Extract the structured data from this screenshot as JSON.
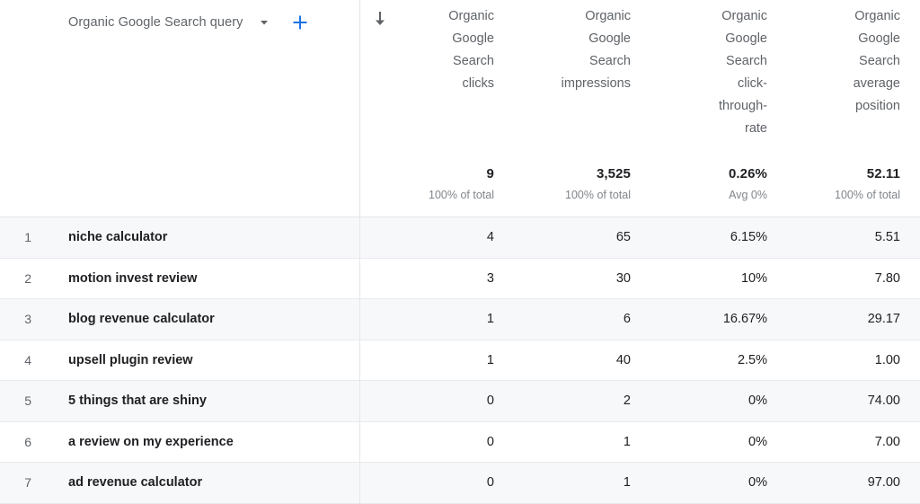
{
  "colors": {
    "accent_blue": "#1a73e8",
    "text_primary": "#202124",
    "text_secondary": "#5f6368",
    "text_muted": "#80868b",
    "row_shade": "#f7f8f9",
    "divider": "#e8eaed"
  },
  "dimension_selector": {
    "label": "Organic Google Search query",
    "caret_icon": "chevron-down-icon",
    "add_icon": "plus-icon"
  },
  "sort": {
    "icon": "arrow-down-icon",
    "column": "Organic Google Search clicks",
    "direction": "descending"
  },
  "columns": [
    {
      "key": "clicks",
      "header": "Organic\nGoogle\nSearch\nclicks"
    },
    {
      "key": "impressions",
      "header": "Organic\nGoogle\nSearch\nimpressions"
    },
    {
      "key": "ctr",
      "header": "Organic\nGoogle\nSearch\nclick-\nthrough-\nrate"
    },
    {
      "key": "position",
      "header": "Organic\nGoogle\nSearch\naverage\nposition"
    }
  ],
  "summary": {
    "clicks": {
      "value": "9",
      "note": "100% of total"
    },
    "impressions": {
      "value": "3,525",
      "note": "100% of total"
    },
    "ctr": {
      "value": "0.26%",
      "note": "Avg 0%"
    },
    "position": {
      "value": "52.11",
      "note": "100% of total"
    }
  },
  "rows": [
    {
      "index": "1",
      "query": "niche calculator",
      "clicks": "4",
      "impressions": "65",
      "ctr": "6.15%",
      "position": "5.51"
    },
    {
      "index": "2",
      "query": "motion invest review",
      "clicks": "3",
      "impressions": "30",
      "ctr": "10%",
      "position": "7.80"
    },
    {
      "index": "3",
      "query": "blog revenue calculator",
      "clicks": "1",
      "impressions": "6",
      "ctr": "16.67%",
      "position": "29.17"
    },
    {
      "index": "4",
      "query": "upsell plugin review",
      "clicks": "1",
      "impressions": "40",
      "ctr": "2.5%",
      "position": "1.00"
    },
    {
      "index": "5",
      "query": "5 things that are shiny",
      "clicks": "0",
      "impressions": "2",
      "ctr": "0%",
      "position": "74.00"
    },
    {
      "index": "6",
      "query": "a review on my experience",
      "clicks": "0",
      "impressions": "1",
      "ctr": "0%",
      "position": "7.00"
    },
    {
      "index": "7",
      "query": "ad revenue calculator",
      "clicks": "0",
      "impressions": "1",
      "ctr": "0%",
      "position": "97.00"
    }
  ]
}
